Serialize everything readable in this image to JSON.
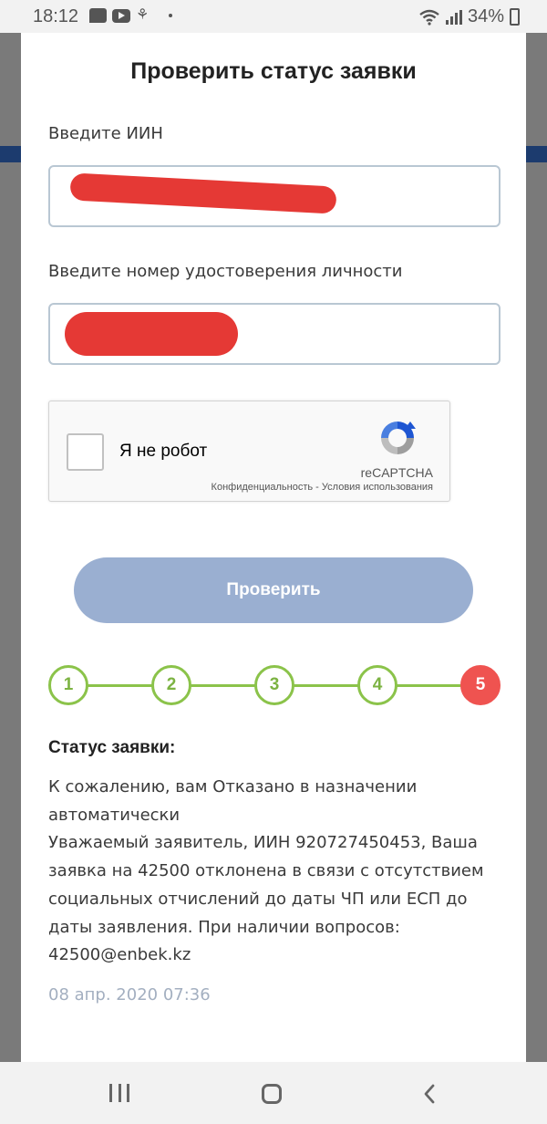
{
  "status_bar": {
    "time": "18:12",
    "icons": [
      "message-icon",
      "youtube-icon",
      "app-icon",
      "dot"
    ],
    "battery": "34%"
  },
  "modal": {
    "title": "Проверить статус заявки",
    "iin": {
      "label": "Введите ИИН",
      "value": ""
    },
    "id_number": {
      "label": "Введите номер удостоверения личности",
      "value": ""
    },
    "recaptcha": {
      "label": "Я не робот",
      "brand": "reCAPTCHA",
      "links": "Конфиденциальность - Условия использования"
    },
    "check_button": "Проверить",
    "steps": [
      "1",
      "2",
      "3",
      "4",
      "5"
    ],
    "active_step": 5,
    "status_heading": "Статус заявки:",
    "status_line1": "К сожалению, вам Отказано в назначении автоматически",
    "status_line2": "Уважаемый заявитель, ИИН 920727450453, Ваша заявка на 42500 отклонена в связи с отсутствием социальных отчислений до даты ЧП или ЕСП до даты заявления. При наличии вопросов: 42500@enbek.kz",
    "status_date": "08 апр. 2020 07:36"
  },
  "colors": {
    "step_green": "#8bc34a",
    "step_active": "#ef5350",
    "button_disabled": "#9aafd1",
    "redaction": "#e53935"
  }
}
